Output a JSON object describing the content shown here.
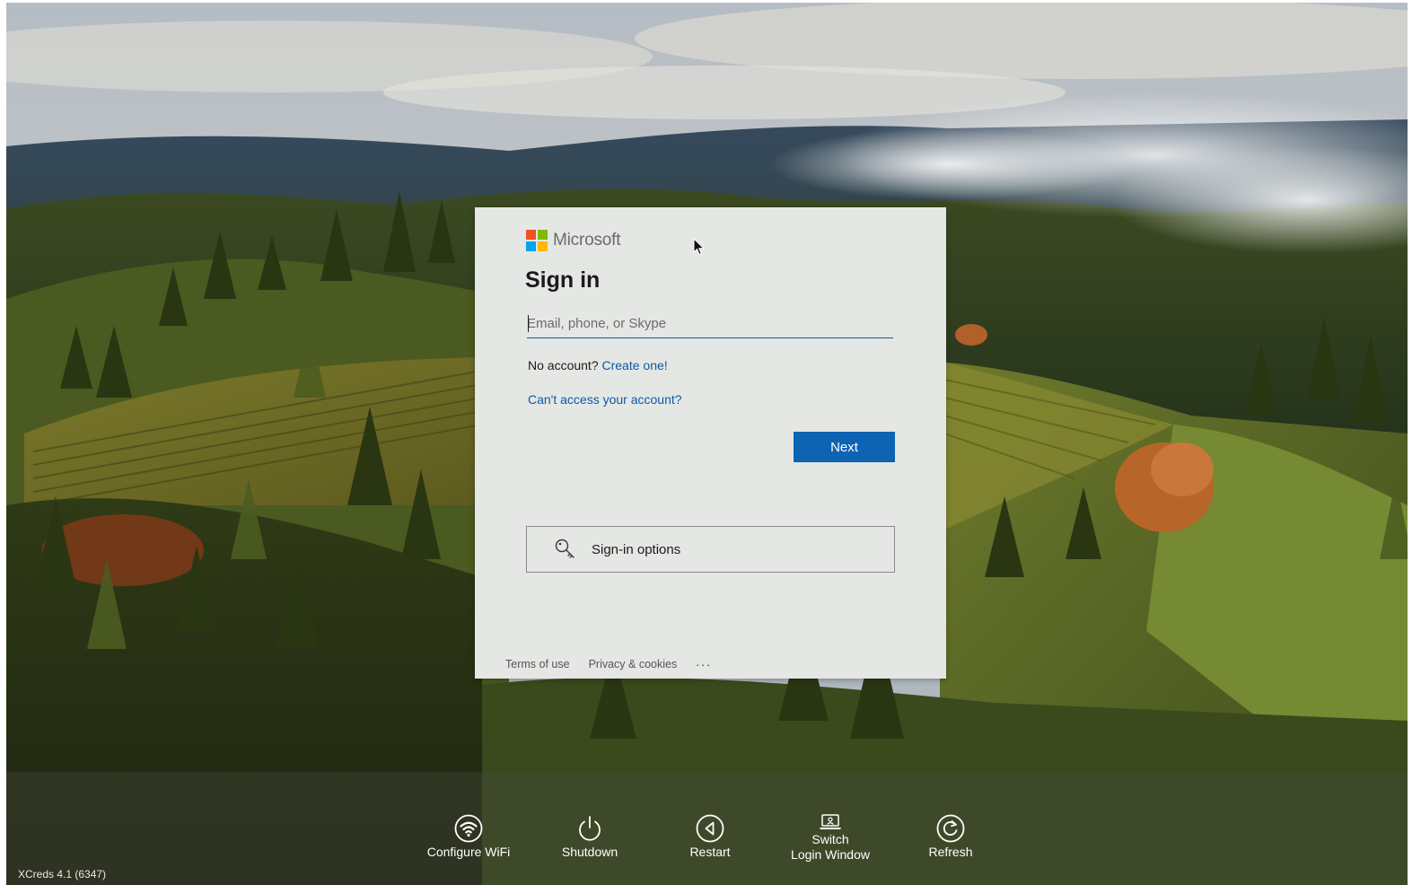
{
  "brand": {
    "name": "Microsoft",
    "colors": [
      "#f25022",
      "#7fba00",
      "#00a4ef",
      "#ffb900"
    ]
  },
  "signin": {
    "title": "Sign in",
    "email_placeholder": "Email, phone, or Skype",
    "no_account_text": "No account?",
    "create_link": "Create one!",
    "cant_access_link": "Can't access your account?",
    "next_label": "Next",
    "options_label": "Sign-in options",
    "options_icon": "key-icon"
  },
  "footer": {
    "terms": "Terms of use",
    "privacy": "Privacy & cookies",
    "more": "..."
  },
  "bottom_bar": {
    "items": [
      {
        "label": "Configure WiFi",
        "icon": "wifi-icon"
      },
      {
        "label": "Shutdown",
        "icon": "power-icon"
      },
      {
        "label": "Restart",
        "icon": "restart-icon"
      },
      {
        "label": "Switch\nLogin Window",
        "icon": "laptop-icon"
      },
      {
        "label": "Refresh",
        "icon": "refresh-icon"
      }
    ]
  },
  "version": "XCreds 4.1 (6347)",
  "accent_color": "#0f63b3"
}
